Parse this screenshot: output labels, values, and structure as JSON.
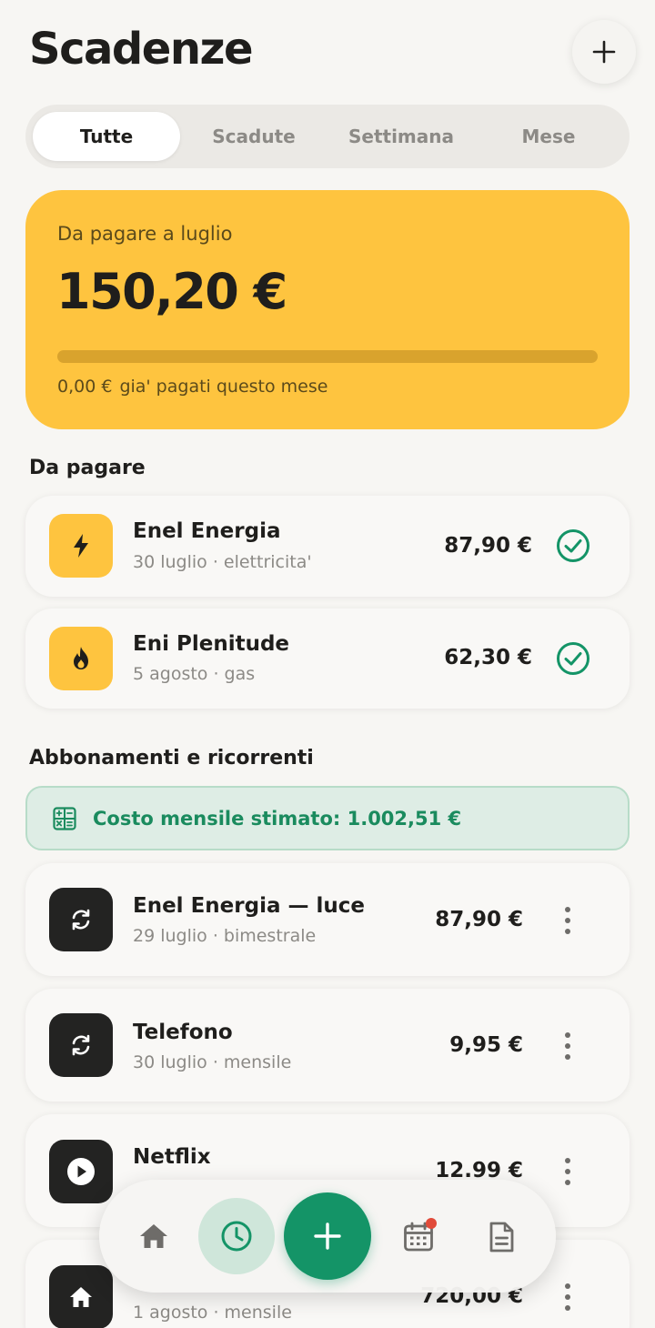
{
  "header": {
    "title": "Scadenze",
    "add_icon": "plus-icon"
  },
  "tabs": [
    {
      "label": "Tutte",
      "active": true
    },
    {
      "label": "Scadute",
      "active": false
    },
    {
      "label": "Settimana",
      "active": false
    },
    {
      "label": "Mese",
      "active": false
    }
  ],
  "summary": {
    "label": "Da pagare a luglio",
    "amount": "150,20 €",
    "paid_amount": "0,00 €",
    "paid_text": "gia' pagati questo mese",
    "progress_fraction": 0,
    "color": "#fec43f"
  },
  "to_pay": {
    "title": "Da pagare",
    "items": [
      {
        "name": "Enel Energia",
        "subtitle": "30 luglio · elettricita'",
        "amount": "87,90 €",
        "icon": "bolt-icon"
      },
      {
        "name": "Eni Plenitude",
        "subtitle": "5 agosto · gas",
        "amount": "62,30 €",
        "icon": "flame-icon"
      }
    ]
  },
  "subscriptions": {
    "title": "Abbonamenti e ricorrenti",
    "estimate": "Costo mensile stimato: 1.002,51 €",
    "items": [
      {
        "name": "Enel Energia — luce",
        "subtitle": "29 luglio · bimestrale",
        "amount": "87,90 €",
        "icon": "refresh-icon"
      },
      {
        "name": "Telefono",
        "subtitle": "30 luglio · mensile",
        "amount": "9,95 €",
        "icon": "refresh-icon"
      },
      {
        "name": "Netflix",
        "subtitle": "",
        "amount": "12.99 €",
        "icon": "play-icon"
      },
      {
        "name": "",
        "subtitle": "1 agosto · mensile",
        "amount": "720,00 €",
        "icon": "home-icon"
      }
    ]
  },
  "bottom_nav": {
    "items": [
      "home-icon",
      "clock-icon",
      "plus-icon",
      "calendar-icon",
      "document-icon"
    ],
    "active": "clock-icon",
    "accent": "#149467"
  }
}
